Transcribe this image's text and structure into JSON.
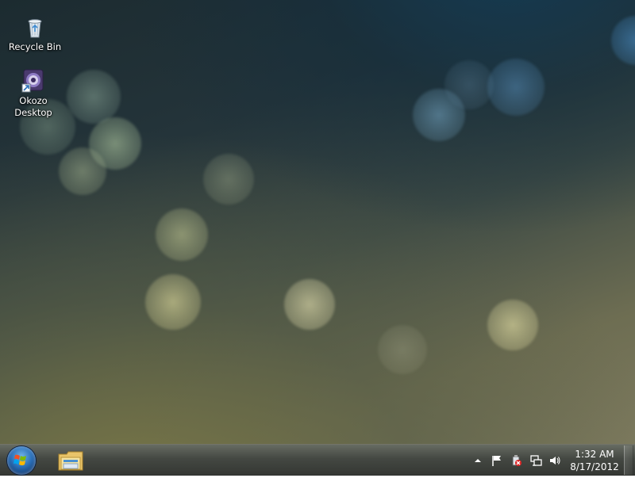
{
  "desktop": {
    "icons": [
      {
        "label": "Recycle Bin",
        "icon": "recycle-bin-icon"
      },
      {
        "label": "Okozo\nDesktop",
        "icon": "okozo-desktop-icon"
      }
    ]
  },
  "taskbar": {
    "start_icon": "windows-start-orb",
    "pinned": [
      {
        "icon": "windows-explorer-icon"
      }
    ],
    "tray": {
      "icons": [
        "show-hidden-icons-arrow",
        "action-center-flag-icon",
        "safely-remove-hardware-icon",
        "network-icon",
        "volume-icon"
      ]
    },
    "clock": {
      "time": "1:32 AM",
      "date": "8/17/2012"
    }
  },
  "colors": {
    "taskbar": "#3a3e38",
    "start_orb": "#2a6fb8",
    "text": "#ffffff"
  }
}
